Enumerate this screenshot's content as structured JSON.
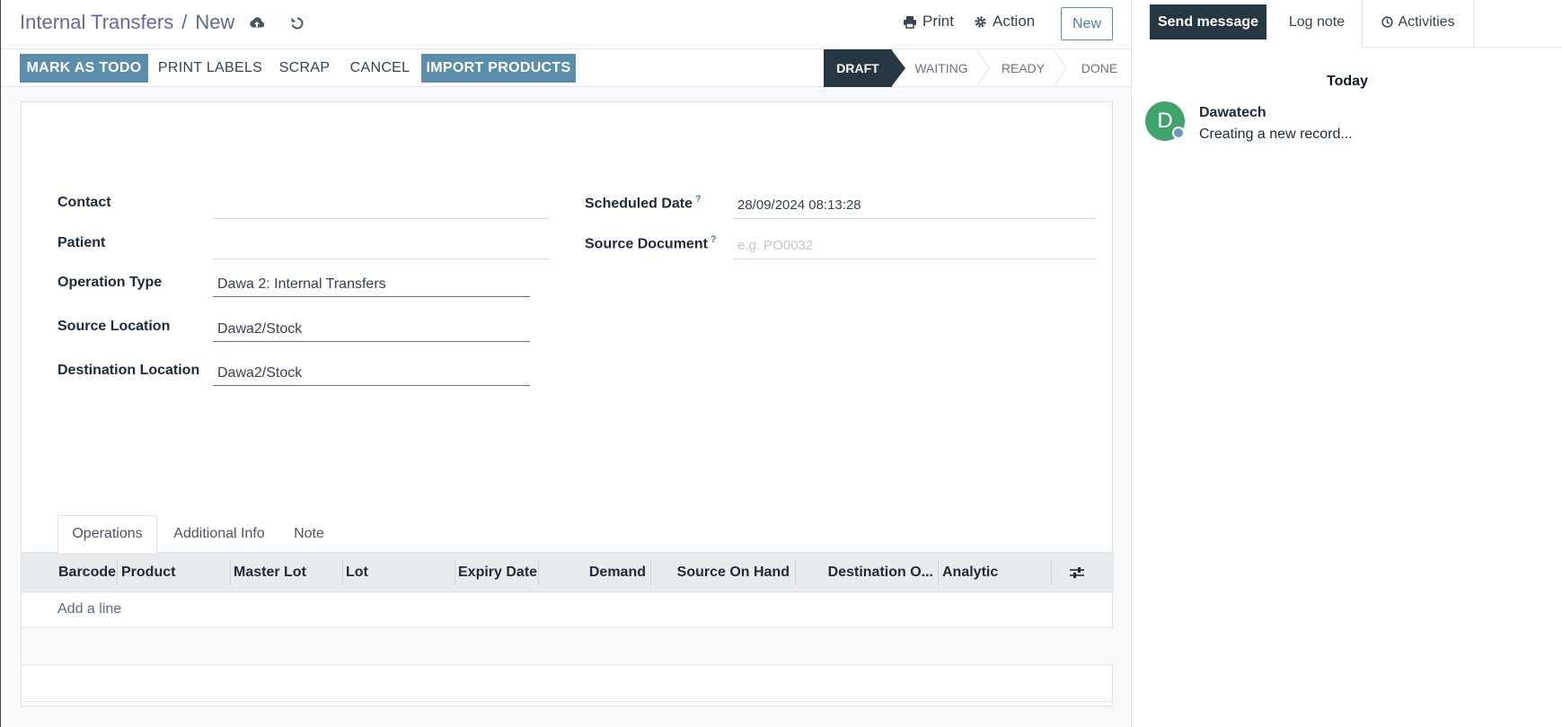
{
  "breadcrumb": {
    "parent": "Internal Transfers",
    "separator": "/",
    "current": "New"
  },
  "control_panel": {
    "print_label": "Print",
    "action_label": "Action",
    "new_label": "New"
  },
  "status_buttons": {
    "mark_as_todo": "MARK AS TODO",
    "print_labels": "PRINT LABELS",
    "scrap": "SCRAP",
    "cancel": "CANCEL",
    "import_products": "IMPORT PRODUCTS"
  },
  "stages": {
    "draft": "DRAFT",
    "waiting": "WAITING",
    "ready": "READY",
    "done": "DONE",
    "active": "DRAFT"
  },
  "form": {
    "contact": {
      "label": "Contact",
      "value": ""
    },
    "patient": {
      "label": "Patient",
      "value": ""
    },
    "operation_type": {
      "label": "Operation Type",
      "value": "Dawa 2: Internal Transfers"
    },
    "source_location": {
      "label": "Source Location",
      "value": "Dawa2/Stock"
    },
    "destination_location": {
      "label": "Destination Location",
      "value": "Dawa2/Stock"
    },
    "scheduled_date": {
      "label": "Scheduled Date",
      "help": "?",
      "value": "28/09/2024 08:13:28"
    },
    "source_document": {
      "label": "Source Document",
      "help": "?",
      "placeholder": "e.g. PO0032"
    }
  },
  "tabs": {
    "operations": "Operations",
    "additional_info": "Additional Info",
    "note": "Note",
    "active": "Operations"
  },
  "operations_table": {
    "columns": {
      "barcode": "Barcode",
      "product": "Product",
      "master_lot": "Master Lot",
      "lot": "Lot",
      "expiry_date": "Expiry Date",
      "demand": "Demand",
      "source_on_hand": "Source On Hand",
      "destination_on_hand": "Destination O...",
      "analytic": "Analytic"
    },
    "add_line": "Add a line"
  },
  "chatter": {
    "send_message": "Send message",
    "log_note": "Log note",
    "activities": "Activities",
    "day_separator": "Today",
    "message": {
      "avatar_initial": "D",
      "author": "Dawatech",
      "body": "Creating a new record..."
    }
  },
  "colors": {
    "primary": "#5b8eab",
    "dark": "#243742",
    "avatar": "#3fa36b",
    "breadcrumb": "#71639e"
  },
  "icons": [
    "cloud-upload-icon",
    "undo-icon",
    "print-icon",
    "gear-icon",
    "clock-icon",
    "column-settings-icon",
    "user-status-dot"
  ]
}
